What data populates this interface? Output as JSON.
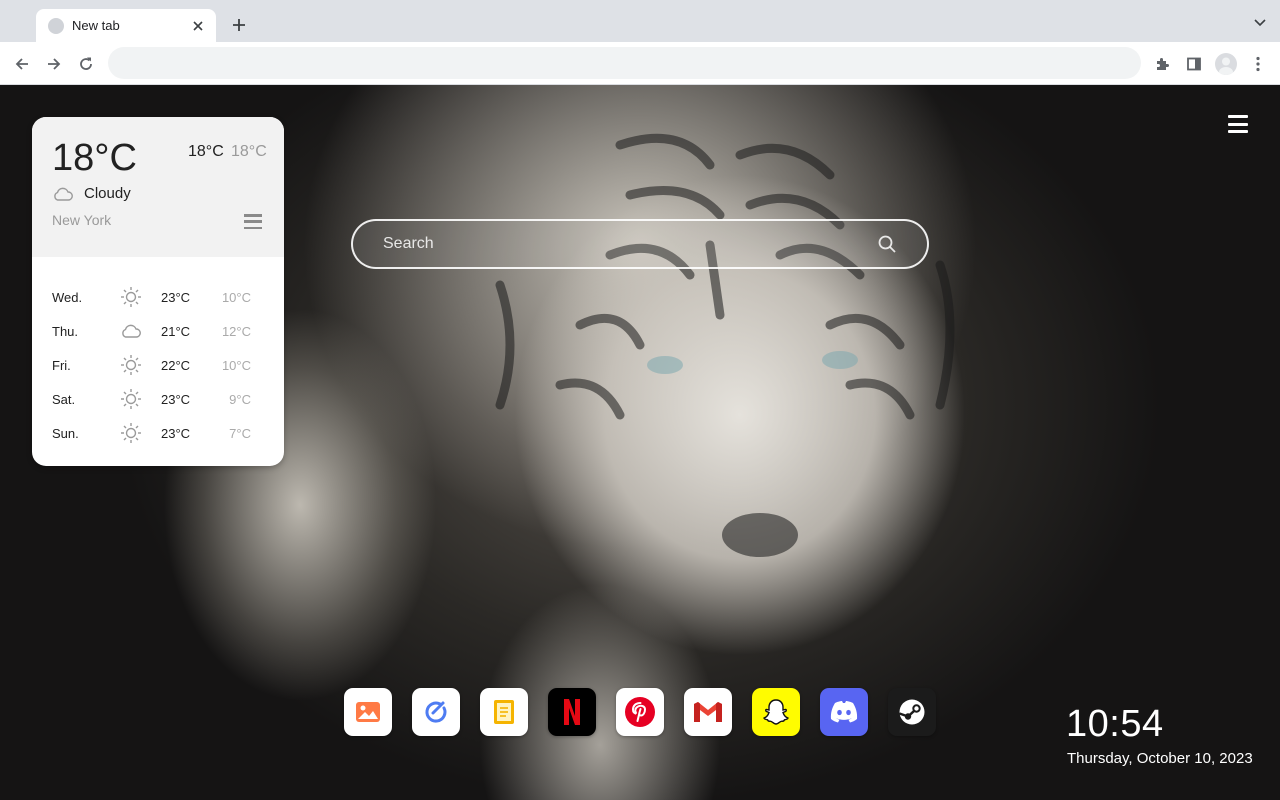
{
  "browser": {
    "tab_title": "New tab",
    "address_value": ""
  },
  "search": {
    "placeholder": "Search"
  },
  "weather": {
    "current_temp": "18°C",
    "high": "18°C",
    "low": "18°C",
    "condition": "Cloudy",
    "city": "New York",
    "forecast": [
      {
        "day": "Wed.",
        "icon": "sun-icon",
        "high": "23°C",
        "low": "10°C"
      },
      {
        "day": "Thu.",
        "icon": "cloud-icon",
        "high": "21°C",
        "low": "12°C"
      },
      {
        "day": "Fri.",
        "icon": "sun-icon",
        "high": "22°C",
        "low": "10°C"
      },
      {
        "day": "Sat.",
        "icon": "sun-icon",
        "high": "23°C",
        "low": "9°C"
      },
      {
        "day": "Sun.",
        "icon": "sun-icon",
        "high": "23°C",
        "low": "7°C"
      }
    ]
  },
  "dock": {
    "apps": [
      {
        "icon": "photos-icon",
        "color": "#ffffff"
      },
      {
        "icon": "tasks-icon",
        "color": "#ffffff"
      },
      {
        "icon": "notes-icon",
        "color": "#ffffff"
      },
      {
        "icon": "netflix-icon",
        "color": "#000000"
      },
      {
        "icon": "pinterest-icon",
        "color": "#ffffff"
      },
      {
        "icon": "gmail-icon",
        "color": "#ffffff"
      },
      {
        "icon": "snapchat-icon",
        "color": "#fffc00"
      },
      {
        "icon": "discord-icon",
        "color": "#5865f2"
      },
      {
        "icon": "steam-icon",
        "color": "#1b1b1b"
      }
    ]
  },
  "clock": {
    "time": "10:54",
    "date": "Thursday, October 10, 2023"
  }
}
